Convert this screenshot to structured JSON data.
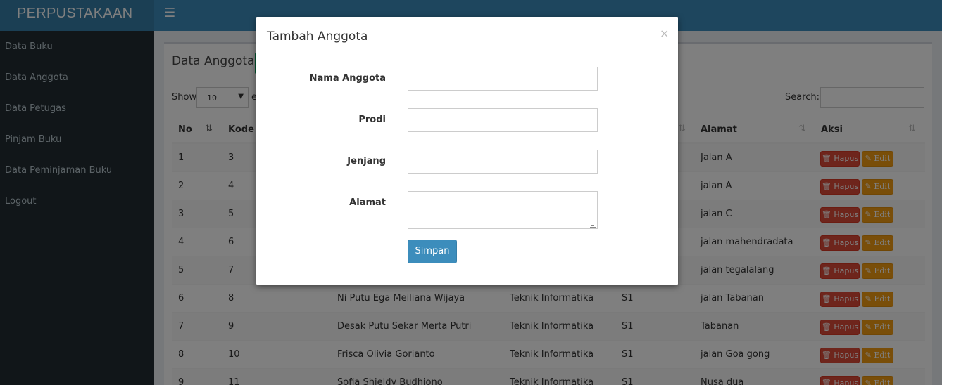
{
  "app": {
    "brand": "PERPUSTAKAAN",
    "menu_icon": "hamburger-icon"
  },
  "sidebar": {
    "items": [
      {
        "label": "Data Buku"
      },
      {
        "label": "Data Anggota"
      },
      {
        "label": "Data Petugas"
      },
      {
        "label": "Pinjam Buku"
      },
      {
        "label": "Data Peminjaman Buku"
      },
      {
        "label": "Logout"
      }
    ]
  },
  "page": {
    "title": "Data Anggota",
    "add_icon": "plus-icon",
    "show_label": "Show",
    "show_value": "10",
    "entries_label": "e",
    "search_label": "Search:",
    "search_value": ""
  },
  "table": {
    "columns": [
      "No",
      "Kode A",
      "Alamat",
      "Aksi"
    ],
    "rows": [
      {
        "no": "1",
        "kode": "3",
        "nama": "",
        "prodi": "",
        "jenjang": "",
        "alamat": "Jalan A"
      },
      {
        "no": "2",
        "kode": "4",
        "nama": "",
        "prodi": "",
        "jenjang": "",
        "alamat": "jalan A"
      },
      {
        "no": "3",
        "kode": "5",
        "nama": "",
        "prodi": "",
        "jenjang": "",
        "alamat": "jalan C"
      },
      {
        "no": "4",
        "kode": "6",
        "nama": "",
        "prodi": "",
        "jenjang": "",
        "alamat": "jalan mahendradata"
      },
      {
        "no": "5",
        "kode": "7",
        "nama": "",
        "prodi": "",
        "jenjang": "",
        "alamat": "jalan tegalalang"
      },
      {
        "no": "6",
        "kode": "8",
        "nama": "Ni Putu Ega Meiliana Wijaya",
        "prodi": "Teknik Informatika",
        "jenjang": "S1",
        "alamat": "jalan Tabanan"
      },
      {
        "no": "7",
        "kode": "9",
        "nama": "Desak Putu Sekar Merta Putri",
        "prodi": "Teknik Informatika",
        "jenjang": "S1",
        "alamat": "Tabanan"
      },
      {
        "no": "8",
        "kode": "10",
        "nama": "Frisca Olivia Gorianto",
        "prodi": "Teknik Informatika",
        "jenjang": "S1",
        "alamat": "jalan Goa gong"
      },
      {
        "no": "9",
        "kode": "11",
        "nama": "Sofia Shieldy Budhiono",
        "prodi": "Teknik Informatika",
        "jenjang": "S1",
        "alamat": "Nusa dua"
      }
    ],
    "hapus_label": "Hapus",
    "edit_label": "Edit"
  },
  "modal": {
    "title": "Tambah Anggota",
    "close": "×",
    "fields": [
      {
        "label": "Nama Anggota",
        "value": ""
      },
      {
        "label": "Prodi",
        "value": ""
      },
      {
        "label": "Jenjang",
        "value": ""
      },
      {
        "label": "Alamat",
        "value": ""
      }
    ],
    "submit_label": "Simpan"
  },
  "colors": {
    "primary": "#3c8dbc",
    "sidebar": "#222d32",
    "danger": "#dd4b39",
    "warning": "#f39c12",
    "success": "#00a65a"
  }
}
